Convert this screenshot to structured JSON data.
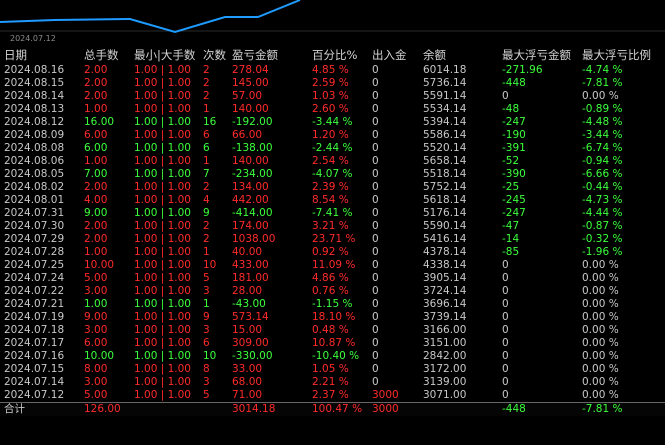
{
  "chart": {
    "x_label": "2024.07.12",
    "line_color": "#1f9bff"
  },
  "columns": [
    "日期",
    "总手数",
    "最小|大手数",
    "次数",
    "盈亏金额",
    "百分比%",
    "出入金",
    "余额",
    "最大浮亏金额",
    "最大浮亏比例"
  ],
  "colors": {
    "profit": "#ff2a2a",
    "loss": "#3cff3c",
    "neutral": "#c8c8c8"
  },
  "rows": [
    {
      "date": "2024.08.16",
      "lots": "2.00",
      "minmax": "1.00 | 1.00",
      "count": "2",
      "pnl": "278.04",
      "pct": "4.85 %",
      "flow": "0",
      "balance": "6014.18",
      "float_amt": "-271.96",
      "float_pct": "-4.74 %",
      "dir": "up"
    },
    {
      "date": "2024.08.15",
      "lots": "2.00",
      "minmax": "1.00 | 1.00",
      "count": "2",
      "pnl": "145.00",
      "pct": "2.59 %",
      "flow": "0",
      "balance": "5736.14",
      "float_amt": "-448",
      "float_pct": "-7.81 %",
      "dir": "up"
    },
    {
      "date": "2024.08.14",
      "lots": "2.00",
      "minmax": "1.00 | 1.00",
      "count": "2",
      "pnl": "57.00",
      "pct": "1.03 %",
      "flow": "0",
      "balance": "5591.14",
      "float_amt": "0",
      "float_pct": "0.00 %",
      "dir": "up"
    },
    {
      "date": "2024.08.13",
      "lots": "1.00",
      "minmax": "1.00 | 1.00",
      "count": "1",
      "pnl": "140.00",
      "pct": "2.60 %",
      "flow": "0",
      "balance": "5534.14",
      "float_amt": "-48",
      "float_pct": "-0.89 %",
      "dir": "up"
    },
    {
      "date": "2024.08.12",
      "lots": "16.00",
      "minmax": "1.00 | 1.00",
      "count": "16",
      "pnl": "-192.00",
      "pct": "-3.44 %",
      "flow": "0",
      "balance": "5394.14",
      "float_amt": "-247",
      "float_pct": "-4.48 %",
      "dir": "down"
    },
    {
      "date": "2024.08.09",
      "lots": "6.00",
      "minmax": "1.00 | 1.00",
      "count": "6",
      "pnl": "66.00",
      "pct": "1.20 %",
      "flow": "0",
      "balance": "5586.14",
      "float_amt": "-190",
      "float_pct": "-3.44 %",
      "dir": "up"
    },
    {
      "date": "2024.08.08",
      "lots": "6.00",
      "minmax": "1.00 | 1.00",
      "count": "6",
      "pnl": "-138.00",
      "pct": "-2.44 %",
      "flow": "0",
      "balance": "5520.14",
      "float_amt": "-391",
      "float_pct": "-6.74 %",
      "dir": "down"
    },
    {
      "date": "2024.08.06",
      "lots": "1.00",
      "minmax": "1.00 | 1.00",
      "count": "1",
      "pnl": "140.00",
      "pct": "2.54 %",
      "flow": "0",
      "balance": "5658.14",
      "float_amt": "-52",
      "float_pct": "-0.94 %",
      "dir": "up"
    },
    {
      "date": "2024.08.05",
      "lots": "7.00",
      "minmax": "1.00 | 1.00",
      "count": "7",
      "pnl": "-234.00",
      "pct": "-4.07 %",
      "flow": "0",
      "balance": "5518.14",
      "float_amt": "-390",
      "float_pct": "-6.66 %",
      "dir": "down"
    },
    {
      "date": "2024.08.02",
      "lots": "2.00",
      "minmax": "1.00 | 1.00",
      "count": "2",
      "pnl": "134.00",
      "pct": "2.39 %",
      "flow": "0",
      "balance": "5752.14",
      "float_amt": "-25",
      "float_pct": "-0.44 %",
      "dir": "up"
    },
    {
      "date": "2024.08.01",
      "lots": "4.00",
      "minmax": "1.00 | 1.00",
      "count": "4",
      "pnl": "442.00",
      "pct": "8.54 %",
      "flow": "0",
      "balance": "5618.14",
      "float_amt": "-245",
      "float_pct": "-4.73 %",
      "dir": "up"
    },
    {
      "date": "2024.07.31",
      "lots": "9.00",
      "minmax": "1.00 | 1.00",
      "count": "9",
      "pnl": "-414.00",
      "pct": "-7.41 %",
      "flow": "0",
      "balance": "5176.14",
      "float_amt": "-247",
      "float_pct": "-4.44 %",
      "dir": "down"
    },
    {
      "date": "2024.07.30",
      "lots": "2.00",
      "minmax": "1.00 | 1.00",
      "count": "2",
      "pnl": "174.00",
      "pct": "3.21 %",
      "flow": "0",
      "balance": "5590.14",
      "float_amt": "-47",
      "float_pct": "-0.87 %",
      "dir": "up"
    },
    {
      "date": "2024.07.29",
      "lots": "2.00",
      "minmax": "1.00 | 1.00",
      "count": "2",
      "pnl": "1038.00",
      "pct": "23.71 %",
      "flow": "0",
      "balance": "5416.14",
      "float_amt": "-14",
      "float_pct": "-0.32 %",
      "dir": "up"
    },
    {
      "date": "2024.07.28",
      "lots": "1.00",
      "minmax": "1.00 | 1.00",
      "count": "1",
      "pnl": "40.00",
      "pct": "0.92 %",
      "flow": "0",
      "balance": "4378.14",
      "float_amt": "-85",
      "float_pct": "-1.96 %",
      "dir": "up"
    },
    {
      "date": "2024.07.25",
      "lots": "10.00",
      "minmax": "1.00 | 1.00",
      "count": "10",
      "pnl": "433.00",
      "pct": "11.09 %",
      "flow": "0",
      "balance": "4338.14",
      "float_amt": "0",
      "float_pct": "0.00 %",
      "dir": "up"
    },
    {
      "date": "2024.07.24",
      "lots": "5.00",
      "minmax": "1.00 | 1.00",
      "count": "5",
      "pnl": "181.00",
      "pct": "4.86 %",
      "flow": "0",
      "balance": "3905.14",
      "float_amt": "0",
      "float_pct": "0.00 %",
      "dir": "up"
    },
    {
      "date": "2024.07.22",
      "lots": "3.00",
      "minmax": "1.00 | 1.00",
      "count": "3",
      "pnl": "28.00",
      "pct": "0.76 %",
      "flow": "0",
      "balance": "3724.14",
      "float_amt": "0",
      "float_pct": "0.00 %",
      "dir": "up"
    },
    {
      "date": "2024.07.21",
      "lots": "1.00",
      "minmax": "1.00 | 1.00",
      "count": "1",
      "pnl": "-43.00",
      "pct": "-1.15 %",
      "flow": "0",
      "balance": "3696.14",
      "float_amt": "0",
      "float_pct": "0.00 %",
      "dir": "down"
    },
    {
      "date": "2024.07.19",
      "lots": "9.00",
      "minmax": "1.00 | 1.00",
      "count": "9",
      "pnl": "573.14",
      "pct": "18.10 %",
      "flow": "0",
      "balance": "3739.14",
      "float_amt": "0",
      "float_pct": "0.00 %",
      "dir": "up"
    },
    {
      "date": "2024.07.18",
      "lots": "3.00",
      "minmax": "1.00 | 1.00",
      "count": "3",
      "pnl": "15.00",
      "pct": "0.48 %",
      "flow": "0",
      "balance": "3166.00",
      "float_amt": "0",
      "float_pct": "0.00 %",
      "dir": "up"
    },
    {
      "date": "2024.07.17",
      "lots": "6.00",
      "minmax": "1.00 | 1.00",
      "count": "6",
      "pnl": "309.00",
      "pct": "10.87 %",
      "flow": "0",
      "balance": "3151.00",
      "float_amt": "0",
      "float_pct": "0.00 %",
      "dir": "up"
    },
    {
      "date": "2024.07.16",
      "lots": "10.00",
      "minmax": "1.00 | 1.00",
      "count": "10",
      "pnl": "-330.00",
      "pct": "-10.40 %",
      "flow": "0",
      "balance": "2842.00",
      "float_amt": "0",
      "float_pct": "0.00 %",
      "dir": "down"
    },
    {
      "date": "2024.07.15",
      "lots": "8.00",
      "minmax": "1.00 | 1.00",
      "count": "8",
      "pnl": "33.00",
      "pct": "1.05 %",
      "flow": "0",
      "balance": "3172.00",
      "float_amt": "0",
      "float_pct": "0.00 %",
      "dir": "up"
    },
    {
      "date": "2024.07.14",
      "lots": "3.00",
      "minmax": "1.00 | 1.00",
      "count": "3",
      "pnl": "68.00",
      "pct": "2.21 %",
      "flow": "0",
      "balance": "3139.00",
      "float_amt": "0",
      "float_pct": "0.00 %",
      "dir": "up"
    },
    {
      "date": "2024.07.12",
      "lots": "5.00",
      "minmax": "1.00 | 1.00",
      "count": "5",
      "pnl": "71.00",
      "pct": "2.37 %",
      "flow": "3000",
      "balance": "3071.00",
      "float_amt": "0",
      "float_pct": "0.00 %",
      "dir": "up"
    }
  ],
  "total": {
    "label": "合计",
    "lots": "126.00",
    "minmax": "",
    "count": "",
    "pnl": "3014.18",
    "pct": "100.47 %",
    "flow": "3000",
    "balance": "",
    "float_amt": "-448",
    "float_pct": "-7.81 %"
  }
}
